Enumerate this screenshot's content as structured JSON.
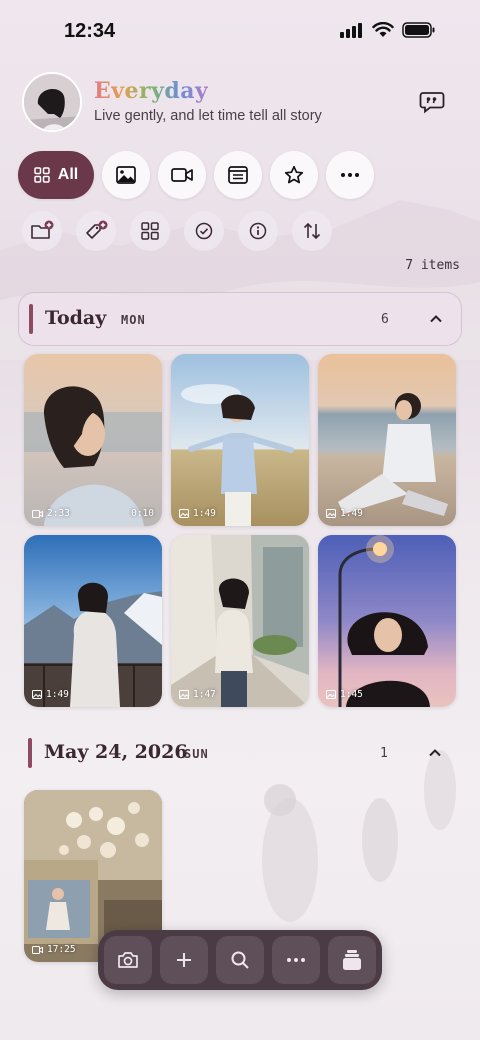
{
  "status": {
    "time": "12:34"
  },
  "header": {
    "title": "Everyday",
    "subtitle": "Live gently, and let time tell all story"
  },
  "filters": [
    {
      "label": "All",
      "icon": "grid-icon",
      "active": true
    },
    {
      "icon": "image-icon"
    },
    {
      "icon": "video-icon"
    },
    {
      "icon": "document-icon"
    },
    {
      "icon": "star-icon"
    },
    {
      "icon": "more-icon"
    }
  ],
  "tools": [
    "folder-add-icon",
    "tag-add-icon",
    "grid-icon",
    "check-circle-icon",
    "info-icon",
    "sort-icon"
  ],
  "item_count": "7 items",
  "sections": [
    {
      "title": "Today",
      "day": "MON",
      "count": "6",
      "items": [
        {
          "type": "video",
          "time": "2:33",
          "duration": "0:10"
        },
        {
          "type": "image",
          "time": "1:49"
        },
        {
          "type": "image",
          "time": "1:49"
        },
        {
          "type": "image",
          "time": "1:49"
        },
        {
          "type": "image",
          "time": "1:47"
        },
        {
          "type": "image",
          "time": "1:45"
        }
      ]
    },
    {
      "title": "May 24, 2026",
      "day": "SUN",
      "count": "1",
      "items": [
        {
          "type": "video",
          "time": "17:25"
        }
      ]
    }
  ],
  "dock": [
    "camera-icon",
    "plus-icon",
    "search-icon",
    "more-icon",
    "stack-icon"
  ],
  "colors": {
    "accent": "#6a3848",
    "dock": "#4a3b44",
    "section_bar": "#8c4b60"
  }
}
